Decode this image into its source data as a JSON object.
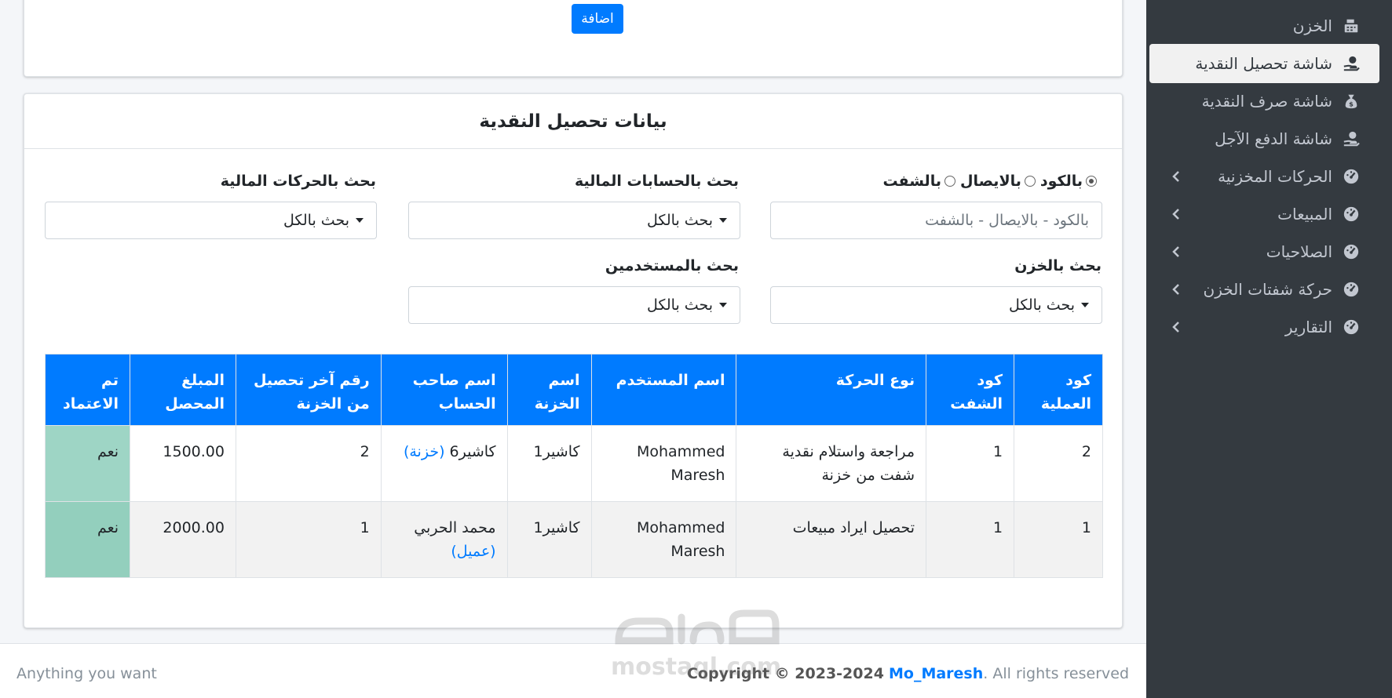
{
  "sidebar": {
    "items": [
      {
        "label": "الخزن",
        "icon": "cash-register-icon"
      },
      {
        "label": "شاشة تحصيل النقدية",
        "icon": "hand-holding-usd-icon",
        "active": true
      },
      {
        "label": "شاشة صرف النقدية",
        "icon": "money-bag-icon"
      },
      {
        "label": "شاشة الدفع الآجل",
        "icon": "hand-holding-usd-icon"
      },
      {
        "label": "الحركات المخزنية",
        "icon": "tachometer-icon",
        "expandable": true
      },
      {
        "label": "المبيعات",
        "icon": "tachometer-icon",
        "expandable": true
      },
      {
        "label": "الصلاحيات",
        "icon": "tachometer-icon",
        "expandable": true
      },
      {
        "label": "حركة شفتات الخزن",
        "icon": "tachometer-icon",
        "expandable": true
      },
      {
        "label": "التقارير",
        "icon": "tachometer-icon",
        "expandable": true
      }
    ]
  },
  "top_card": {
    "add_button": "اضافة"
  },
  "main_card": {
    "title": "بيانات تحصيل النقدية",
    "radios": {
      "by_code": "بالكود",
      "by_receipt": "بالايصال",
      "by_shift": "بالشفت"
    },
    "search_placeholder": "بالكود - بالايصال - بالشفت",
    "filters": {
      "accounts_label": "بحث بالحسابات المالية",
      "movements_label": "بحث بالحركات المالية",
      "treasuries_label": "بحث بالخزن",
      "users_label": "بحث بالمستخدمين",
      "select_all": "بحث بالكل"
    },
    "table": {
      "headers": [
        "كود العملية",
        "كود الشفت",
        "نوع الحركة",
        "اسم المستخدم",
        "اسم الخزنة",
        "اسم صاحب الحساب",
        "رقم آخر تحصيل من الخزنة",
        "المبلغ المحصل",
        "تم الاعتماد"
      ],
      "rows": [
        {
          "op_code": "2",
          "shift_code": "1",
          "movement": "مراجعة واستلام نقدية شفت من خزنة",
          "user": "Mohammed Maresh",
          "treasury": "كاشير1",
          "account": "كاشير6",
          "account_type": "(خزنة)",
          "last_collection": "2",
          "amount": "1500.00",
          "approved": "نعم"
        },
        {
          "op_code": "1",
          "shift_code": "1",
          "movement": "تحصيل ايراد مبيعات",
          "user": "Mohammed Maresh",
          "treasury": "كاشير1",
          "account": "محمد الحربي",
          "account_type": "(عميل)",
          "last_collection": "1",
          "amount": "2000.00",
          "approved": "نعم"
        }
      ]
    }
  },
  "footer": {
    "left": "Anything you want",
    "copyright": "Copyright © 2023-2024",
    "author": "Mo_Maresh",
    "rights": ". All rights reserved"
  },
  "watermark": {
    "text": "mostaql.com",
    "logo_text": "مستقل"
  }
}
